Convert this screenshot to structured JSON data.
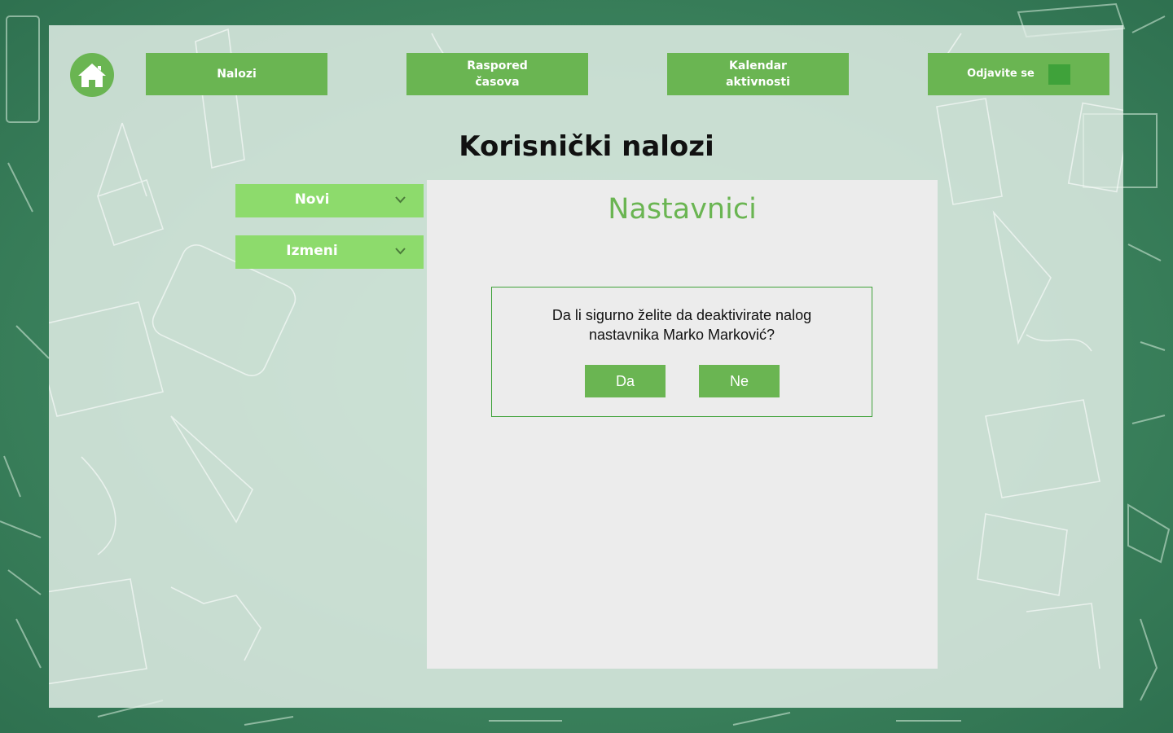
{
  "nav": {
    "accounts": "Nalozi",
    "schedule_line1": "Raspored",
    "schedule_line2": "časova",
    "calendar_line1": "Kalendar",
    "calendar_line2": "aktivnosti",
    "logout": "Odjavite se"
  },
  "page": {
    "title": "Korisnički nalozi"
  },
  "sidebar": {
    "items": [
      {
        "label": "Novi"
      },
      {
        "label": "Izmeni"
      }
    ]
  },
  "content": {
    "title": "Nastavnici"
  },
  "dialog": {
    "line1": "Da li sigurno želite da deaktivirate nalog",
    "line2": "nastavnika Marko Marković?",
    "yes": "Da",
    "no": "Ne"
  },
  "colors": {
    "primary": "#6ab552",
    "sidebar": "#8ddb6c",
    "background": "#3d7a59",
    "dialog_border": "#3fa23a"
  },
  "icons": [
    "home-icon",
    "chevron-down-icon"
  ]
}
